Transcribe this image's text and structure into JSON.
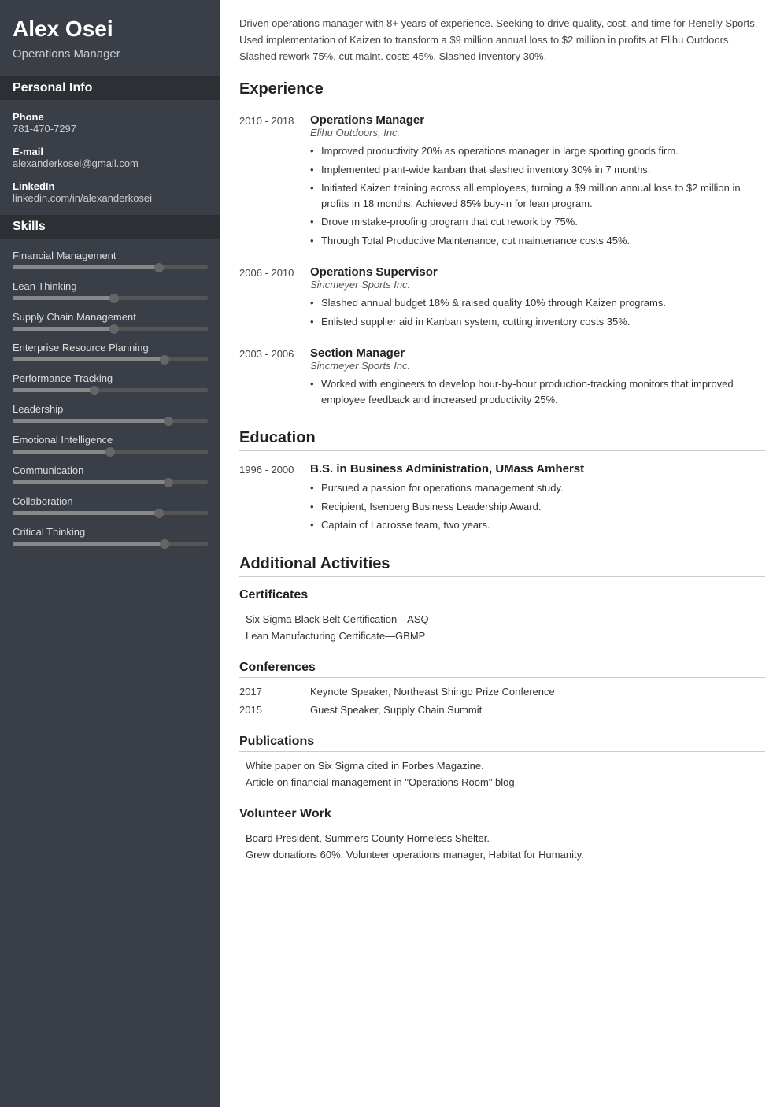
{
  "sidebar": {
    "name": "Alex Osei",
    "title": "Operations Manager",
    "personal_info_label": "Personal Info",
    "phone_label": "Phone",
    "phone_value": "781-470-7297",
    "email_label": "E-mail",
    "email_value": "alexanderkosei@gmail.com",
    "linkedin_label": "LinkedIn",
    "linkedin_value": "linkedin.com/in/alexanderkosei",
    "skills_label": "Skills",
    "skills": [
      {
        "name": "Financial Management",
        "fill_pct": 75,
        "dot_pct": 75
      },
      {
        "name": "Lean Thinking",
        "fill_pct": 52,
        "dot_pct": 52
      },
      {
        "name": "Supply Chain Management",
        "fill_pct": 52,
        "dot_pct": 52
      },
      {
        "name": "Enterprise Resource Planning",
        "fill_pct": 78,
        "dot_pct": 78
      },
      {
        "name": "Performance Tracking",
        "fill_pct": 42,
        "dot_pct": 42
      },
      {
        "name": "Leadership",
        "fill_pct": 80,
        "dot_pct": 80
      },
      {
        "name": "Emotional Intelligence",
        "fill_pct": 50,
        "dot_pct": 50
      },
      {
        "name": "Communication",
        "fill_pct": 80,
        "dot_pct": 80
      },
      {
        "name": "Collaboration",
        "fill_pct": 75,
        "dot_pct": 75
      },
      {
        "name": "Critical Thinking",
        "fill_pct": 78,
        "dot_pct": 78
      }
    ]
  },
  "main": {
    "summary": "Driven operations manager with 8+ years of experience. Seeking to drive quality, cost, and time for Renelly Sports. Used implementation of Kaizen to transform a $9 million annual loss to $2 million in profits at Elihu Outdoors. Slashed rework 75%, cut maint. costs 45%. Slashed inventory 30%.",
    "experience_label": "Experience",
    "experience": [
      {
        "dates": "2010 - 2018",
        "title": "Operations Manager",
        "company": "Elihu Outdoors, Inc.",
        "bullets": [
          "Improved productivity 20% as operations manager in large sporting goods firm.",
          "Implemented plant-wide kanban that slashed inventory 30% in 7 months.",
          "Initiated Kaizen training across all employees, turning a $9 million annual loss to $2 million in profits in 18 months. Achieved 85% buy-in for lean program.",
          "Drove mistake-proofing program that cut rework by 75%.",
          "Through Total Productive Maintenance, cut maintenance costs 45%."
        ]
      },
      {
        "dates": "2006 - 2010",
        "title": "Operations Supervisor",
        "company": "Sincmeyer Sports Inc.",
        "bullets": [
          "Slashed annual budget 18% & raised quality 10% through Kaizen programs.",
          "Enlisted supplier aid in Kanban system, cutting inventory costs 35%."
        ]
      },
      {
        "dates": "2003 - 2006",
        "title": "Section Manager",
        "company": "Sincmeyer Sports Inc.",
        "bullets": [
          "Worked with engineers to develop hour-by-hour production-tracking monitors that improved employee feedback and increased productivity 25%."
        ]
      }
    ],
    "education_label": "Education",
    "education": [
      {
        "dates": "1996 - 2000",
        "degree": "B.S. in Business Administration, UMass Amherst",
        "bullets": [
          "Pursued a passion for operations management study.",
          "Recipient, Isenberg Business Leadership Award.",
          "Captain of Lacrosse team, two years."
        ]
      }
    ],
    "additional_label": "Additional Activities",
    "certificates_label": "Certificates",
    "certificates": [
      "Six Sigma Black Belt Certification—ASQ",
      "Lean Manufacturing Certificate—GBMP"
    ],
    "conferences_label": "Conferences",
    "conferences": [
      {
        "year": "2017",
        "text": "Keynote Speaker, Northeast Shingo Prize Conference"
      },
      {
        "year": "2015",
        "text": "Guest Speaker, Supply Chain Summit"
      }
    ],
    "publications_label": "Publications",
    "publications": [
      "White paper on Six Sigma cited in Forbes Magazine.",
      "Article on financial management in \"Operations Room\" blog."
    ],
    "volunteer_label": "Volunteer Work",
    "volunteer": [
      "Board President, Summers County Homeless Shelter.",
      "Grew donations 60%. Volunteer operations manager, Habitat for Humanity."
    ]
  }
}
